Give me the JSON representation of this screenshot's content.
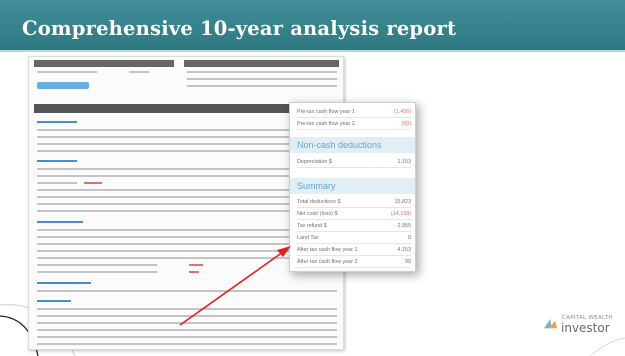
{
  "slide": {
    "title": "Comprehensive 10-year analysis report"
  },
  "zoom": {
    "rows_top": [
      {
        "label": "Pre-tax cash flow year 1",
        "value": "(1,456)",
        "value_color": "red"
      },
      {
        "label": "Pre-tax cash flow year 2",
        "value": "(60)",
        "value_color": "red"
      }
    ],
    "noncash": {
      "heading": "Non-cash deductions",
      "rows": [
        {
          "label": "Depreciation $",
          "value": "1,153",
          "value_color": "plain"
        }
      ]
    },
    "summary": {
      "heading": "Summary",
      "rows": [
        {
          "label": "Total deductions $",
          "value": "15,823",
          "value_color": "plain"
        },
        {
          "label": "Net cost/ (loss) $",
          "value": "(14,158)",
          "value_color": "red"
        },
        {
          "label": "Tax refund $",
          "value": "2,955",
          "value_color": "plain"
        },
        {
          "label": "Land Tax",
          "value": "0",
          "value_color": "plain"
        },
        {
          "label": "After tax cash flow year 1",
          "value": "4,153",
          "value_color": "plain"
        },
        {
          "label": "After tax cash flow year 2",
          "value": "99",
          "value_color": "plain"
        }
      ]
    }
  },
  "logo": {
    "top_text": "CAPITAL WEALTH",
    "main_text": "investor"
  },
  "colors": {
    "header_teal": "#2f7882",
    "accent_blue": "#63a8d0",
    "negative_red": "#e36f6f",
    "arrow_red": "#e02020"
  }
}
